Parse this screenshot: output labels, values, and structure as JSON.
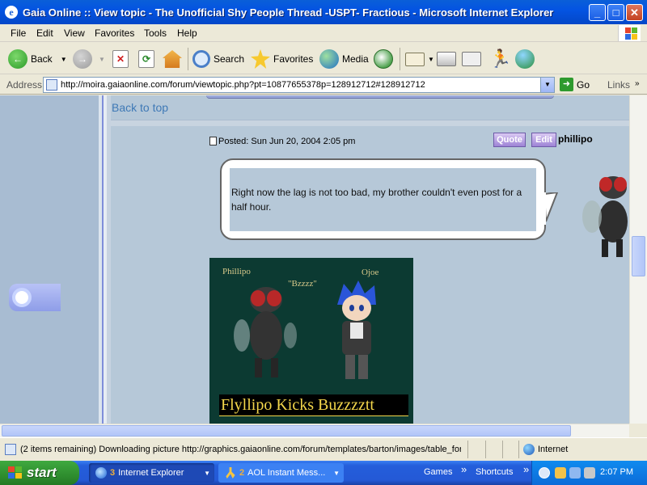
{
  "window": {
    "title": "Gaia Online :: View topic - The Unofficial Shy People Thread -USPT- Fractious - Microsoft Internet Explorer",
    "minimize": "_",
    "maximize": "□",
    "close": "✕"
  },
  "menu": [
    "File",
    "Edit",
    "View",
    "Favorites",
    "Tools",
    "Help"
  ],
  "toolbar": {
    "back": "Back",
    "search": "Search",
    "favorites": "Favorites",
    "media": "Media"
  },
  "address": {
    "label": "Address",
    "url": "http://moira.gaiaonline.com/forum/viewtopic.php?pt=10877655378p=128912712#128912712",
    "go": "Go",
    "links": "Links"
  },
  "page": {
    "back_to_top": "Back to top",
    "posted": "Posted: Sun Jun 20, 2004 2:05 pm",
    "quote_btn": "Quote",
    "edit_btn": "Edit",
    "username": "phillipo",
    "message": "Right now the lag is not too bad, my brother couldn't even post for a half hour.",
    "image": {
      "label_left": "Phillipo",
      "label_mid": "\"Bzzzz\"",
      "label_right": "Ojoe",
      "caption": "Flyllipo Kicks Buzzzztt"
    }
  },
  "status": {
    "text": "(2 items remaining) Downloading picture http://graphics.gaiaonline.com/forum/templates/barton/images/table_for",
    "zone": "Internet"
  },
  "taskbar": {
    "start": "start",
    "tasks": [
      {
        "count": "3",
        "label": "Internet Explorer"
      },
      {
        "count": "2",
        "label": "AOL Instant Mess..."
      }
    ],
    "quick": [
      "Games",
      "Shortcuts"
    ],
    "quick_more": "»",
    "clock": "2:07 PM"
  },
  "colors": {
    "xp_blue": "#0454E2",
    "content_bg": "#B6C8D8",
    "link": "#3F79B6",
    "button_purple": "#9E84D6",
    "caption_yellow": "#F3D64B"
  }
}
